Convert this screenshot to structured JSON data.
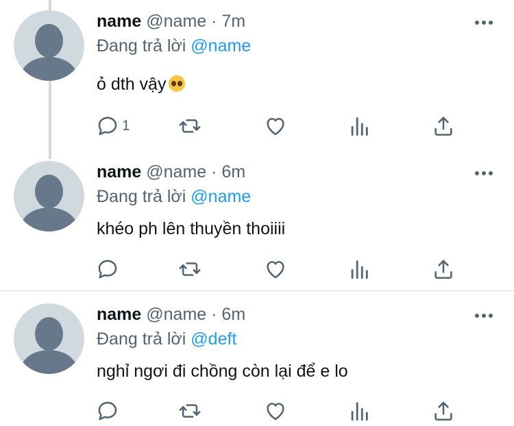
{
  "tweets": [
    {
      "name": "name",
      "handle": "@name",
      "sep": "·",
      "time": "7m",
      "replying_prefix": "Đang trả lời",
      "replying_to": "@name",
      "text": "ỏ dth vậy",
      "emoji": "pleading-face-emoji",
      "reply_count": "1"
    },
    {
      "name": "name",
      "handle": "@name",
      "sep": "·",
      "time": "6m",
      "replying_prefix": "Đang trả lời",
      "replying_to": "@name",
      "text": "khéo ph lên thuyền thoiiii",
      "reply_count": ""
    },
    {
      "name": "name",
      "handle": "@name",
      "sep": "·",
      "time": "6m",
      "replying_prefix": "Đang trả lời",
      "replying_to": "@deft",
      "text": "nghỉ ngơi đi chồng còn lại để e lo",
      "reply_count": ""
    }
  ],
  "colors": {
    "link": "#1d9bf0",
    "secondary_text": "#536471",
    "avatar_bg": "#cfd9de",
    "avatar_fg": "#66788a"
  },
  "icons": [
    "reply-icon",
    "retweet-icon",
    "like-icon",
    "views-icon",
    "share-icon",
    "more-options-icon"
  ]
}
